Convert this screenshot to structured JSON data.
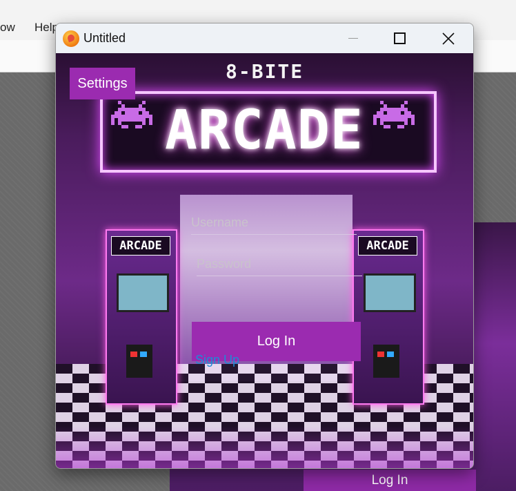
{
  "background_app": {
    "menu_items": [
      "ow",
      "Help"
    ],
    "login_label": "Log In"
  },
  "window": {
    "title": "Untitled",
    "controls": {
      "minimize": "minimize-icon",
      "maximize": "maximize-icon",
      "close": "close-icon"
    }
  },
  "poster": {
    "brand_small": "8-BITE",
    "brand_large": "ARCADE",
    "cabinet_label": "ARCADE"
  },
  "settings": {
    "label": "Settings"
  },
  "login_form": {
    "username_placeholder": "Username",
    "password_placeholder": "Password",
    "login_label": "Log In",
    "signup_label": "Sign Up"
  },
  "colors": {
    "accent": "#9b2bb0",
    "link": "#1e8ad6",
    "neon": "#e04cff"
  }
}
